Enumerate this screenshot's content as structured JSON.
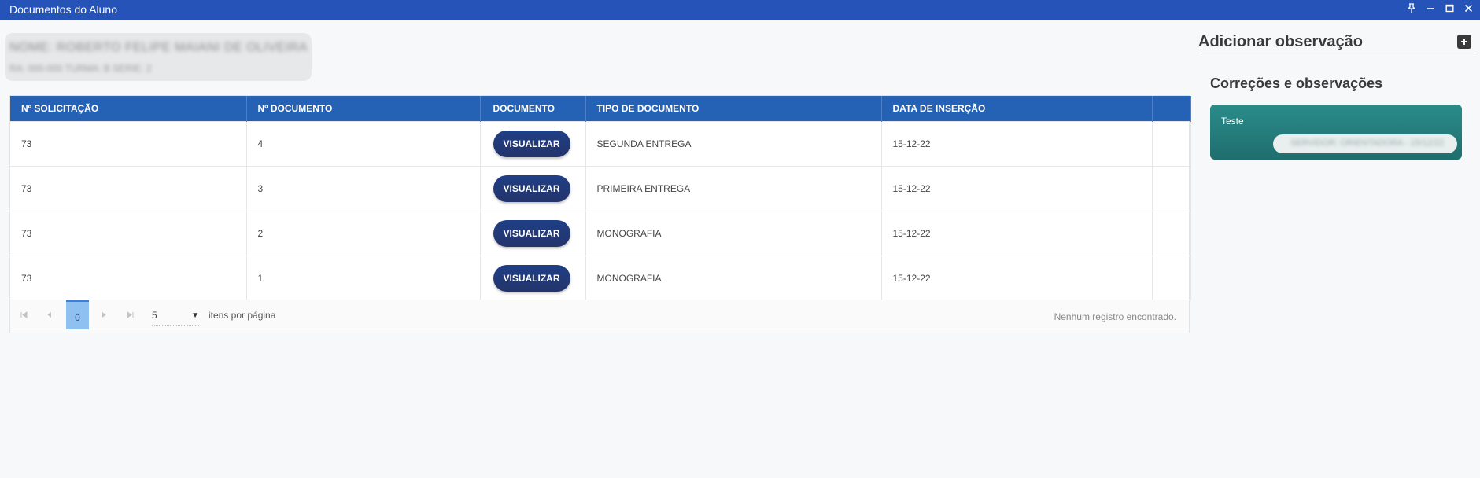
{
  "window": {
    "title": "Documentos do Aluno",
    "controls": [
      "pin-icon",
      "minimize-icon",
      "maximize-icon",
      "close-icon"
    ]
  },
  "student": {
    "name": "NOME: ROBERTO FELIPE MAIANI DE OLIVEIRA",
    "sub": "RA: 000-000 TURMA: B SERIE: 2"
  },
  "table": {
    "headers": [
      "Nº SOLICITAÇÃO",
      "Nº DOCUMENTO",
      "DOCUMENTO",
      "TIPO DE DOCUMENTO",
      "DATA DE INSERÇÃO",
      ""
    ],
    "rows": [
      {
        "solicitacao": "73",
        "documento_num": "4",
        "button": "VISUALIZAR",
        "tipo": "SEGUNDA ENTREGA",
        "data": "15-12-22"
      },
      {
        "solicitacao": "73",
        "documento_num": "3",
        "button": "VISUALIZAR",
        "tipo": "PRIMEIRA ENTREGA",
        "data": "15-12-22"
      },
      {
        "solicitacao": "73",
        "documento_num": "2",
        "button": "VISUALIZAR",
        "tipo": "MONOGRAFIA",
        "data": "15-12-22"
      },
      {
        "solicitacao": "73",
        "documento_num": "1",
        "button": "VISUALIZAR",
        "tipo": "MONOGRAFIA",
        "data": "15-12-22"
      }
    ]
  },
  "pager": {
    "current_page": "0",
    "page_size": "5",
    "per_page_label": "itens por página",
    "empty_message": "Nenhum registro encontrado."
  },
  "observations": {
    "add_heading": "Adicionar observação",
    "section_title": "Correções e observações",
    "items": [
      {
        "title": "Teste",
        "meta": "SERVIDOR: ORIENTADORA - 15/12/22"
      }
    ]
  },
  "colors": {
    "titlebar": "#2553b8",
    "table_header": "#2562b5",
    "button": "#24346b",
    "obs_card": "#2a8c8a"
  }
}
